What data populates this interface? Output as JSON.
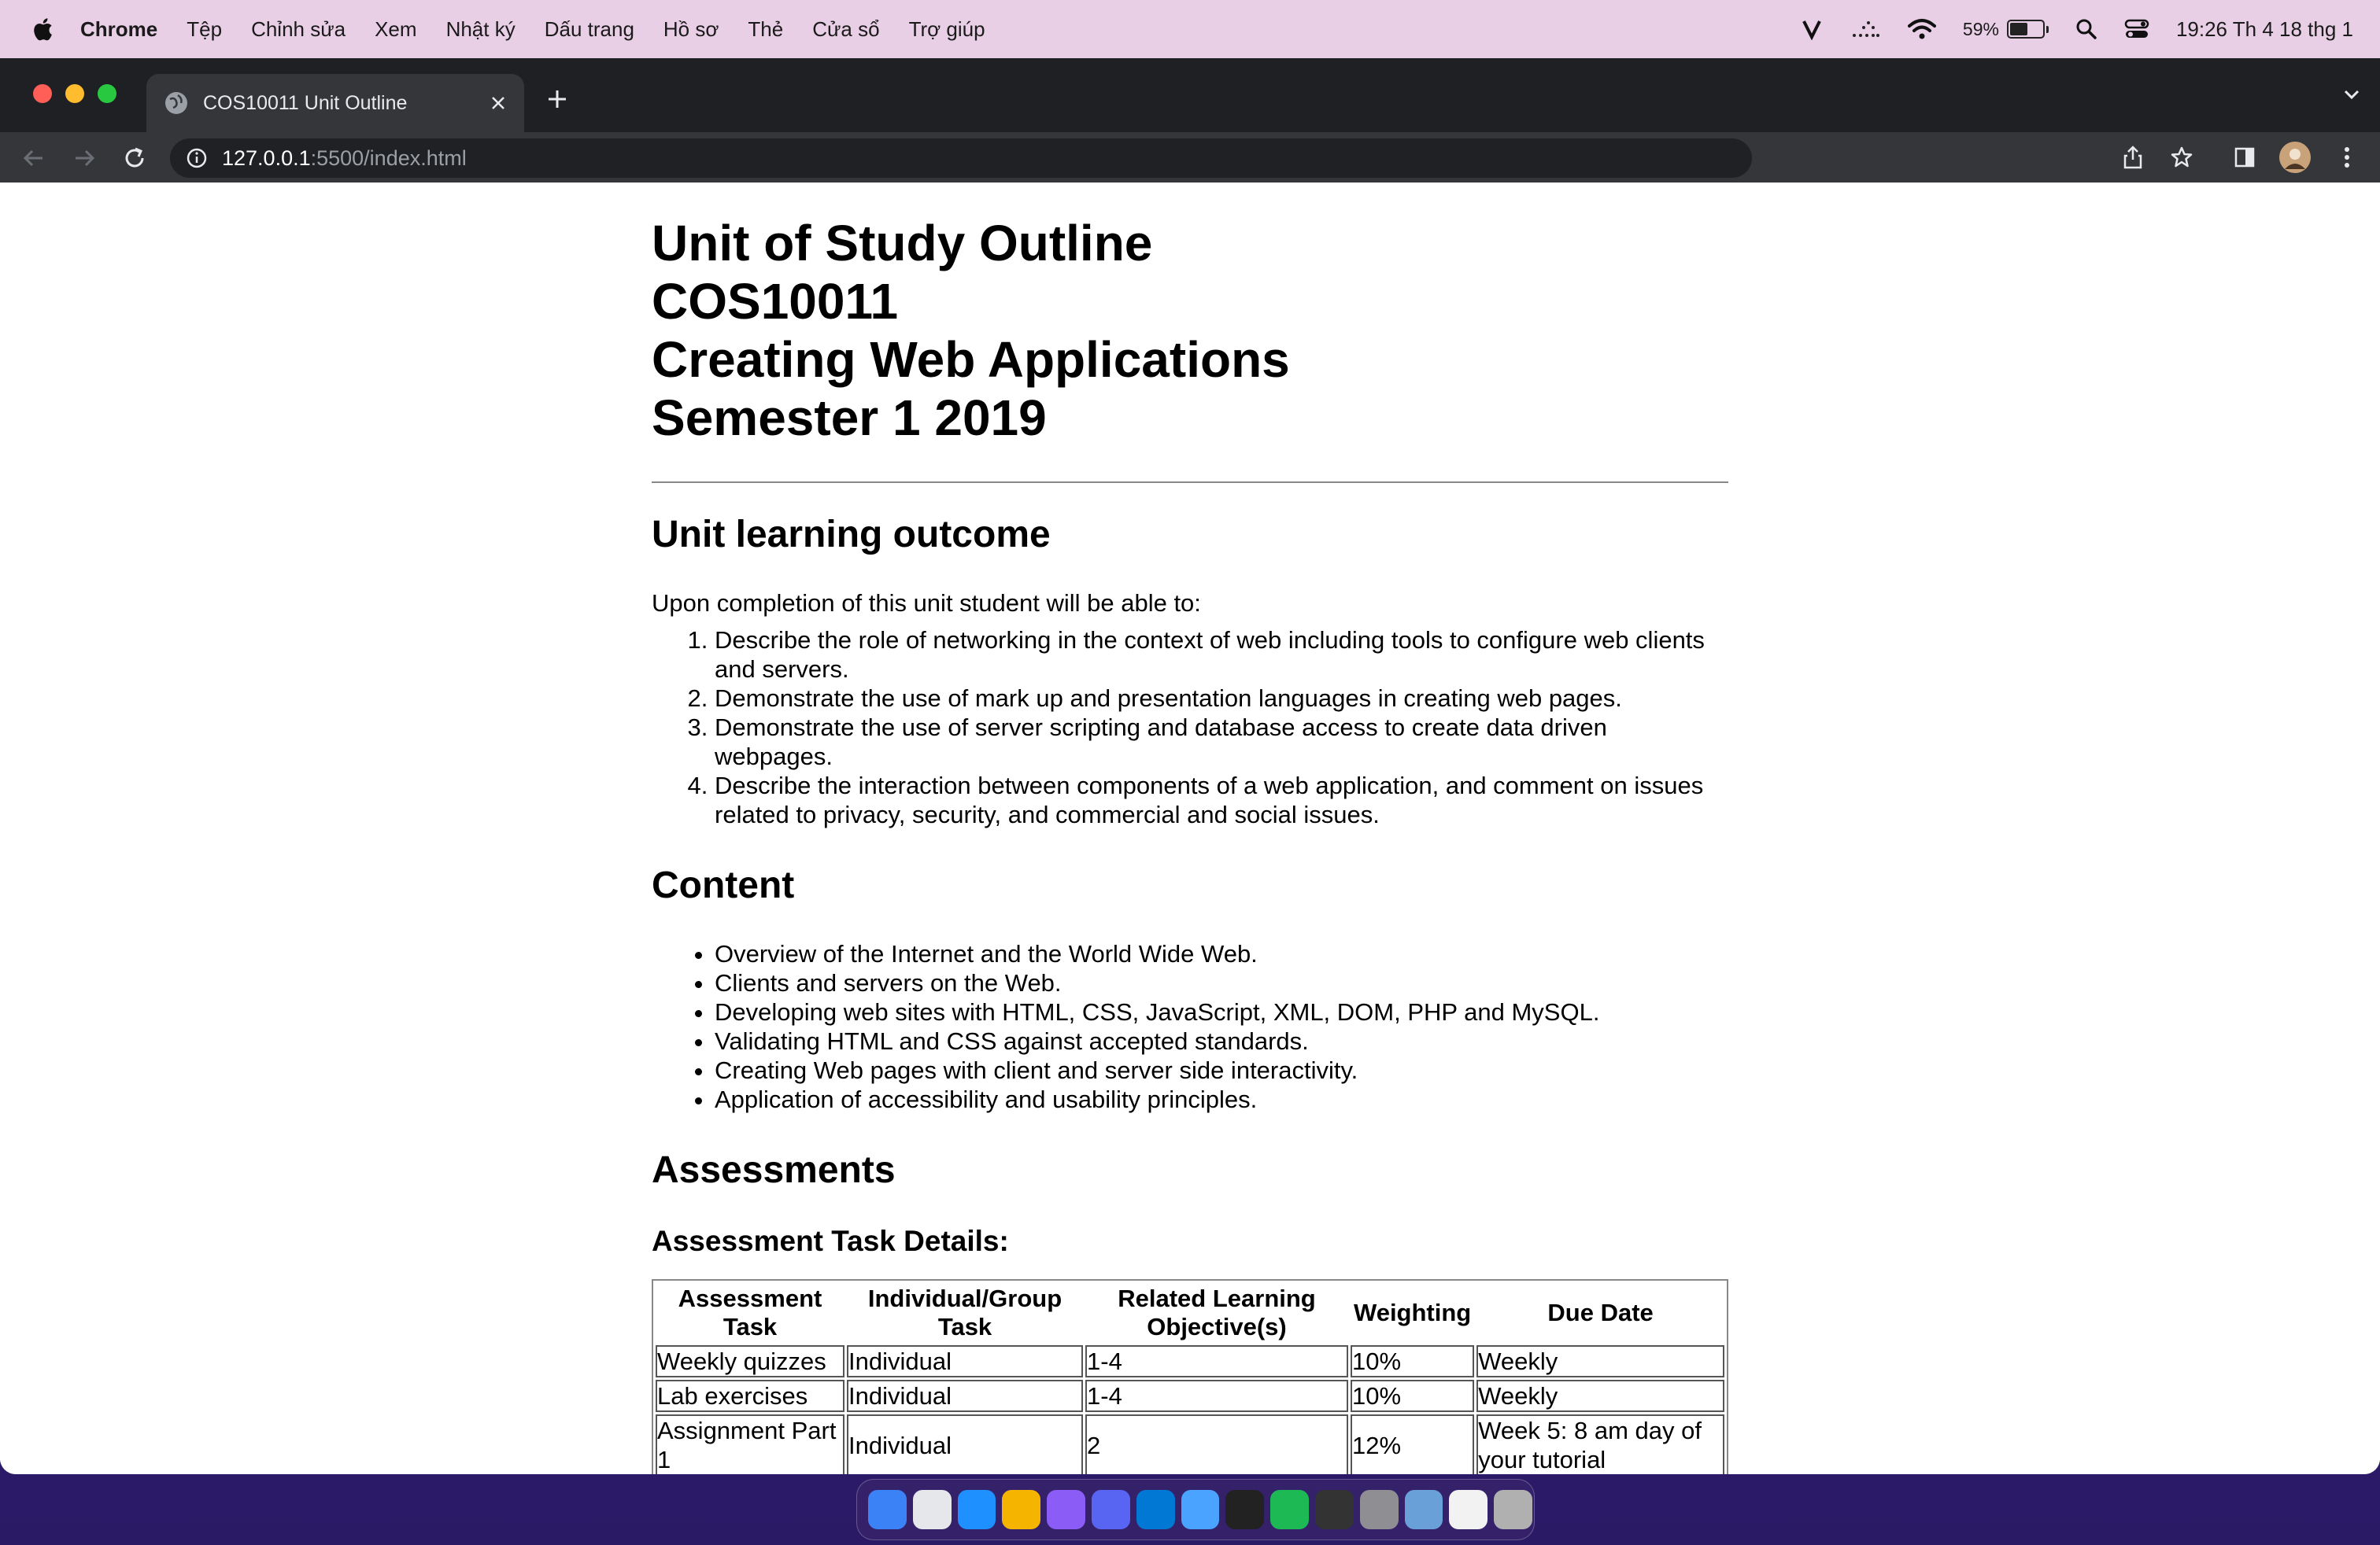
{
  "menubar": {
    "app_name": "Chrome",
    "items": [
      "Tệp",
      "Chỉnh sửa",
      "Xem",
      "Nhật ký",
      "Dấu trang",
      "Hồ sơ",
      "Thẻ",
      "Cửa sổ",
      "Trợ giúp"
    ],
    "battery_percent": "59%",
    "battery_level": 0.59,
    "clock": "19:26 Th 4 18 thg 1"
  },
  "browser": {
    "tab_title": "COS10011 Unit Outline",
    "url_host": "127.0.0.1",
    "url_path": ":5500/index.html"
  },
  "page": {
    "title_lines": [
      "Unit of Study Outline",
      "COS10011",
      "Creating Web Applications",
      "Semester 1 2019"
    ],
    "outcome_heading": "Unit learning outcome",
    "outcome_intro": "Upon completion of this unit student will be able to:",
    "outcomes": [
      "Describe the role of networking in the context of web including tools to configure web clients and servers.",
      "Demonstrate the use of mark up and presentation languages in creating web pages.",
      "Demonstrate the use of server scripting and database access to create data driven webpages.",
      "Describe the interaction between components of a web application, and comment on issues related to privacy, security, and commercial and social issues."
    ],
    "content_heading": "Content",
    "content_items": [
      "Overview of the Internet and the World Wide Web.",
      "Clients and servers on the Web.",
      "Developing web sites with HTML, CSS, JavaScript, XML, DOM, PHP and MySQL.",
      "Validating HTML and CSS against accepted standards.",
      "Creating Web pages with client and server side interactivity.",
      "Application of accessibility and usability principles."
    ],
    "assessments_heading": "Assessments",
    "task_details_heading": "Assessment Task Details:",
    "table": {
      "headers": [
        "Assessment Task",
        "Individual/Group Task",
        "Related Learning Objective(s)",
        "Weighting",
        "Due Date"
      ],
      "rows": [
        [
          "Weekly quizzes",
          "Individual",
          "1-4",
          "10%",
          "Weekly"
        ],
        [
          "Lab exercises",
          "Individual",
          "1-4",
          "10%",
          "Weekly"
        ],
        [
          "Assignment Part 1",
          "Individual",
          "2",
          "12%",
          "Week 5: 8 am day of your tutorial"
        ]
      ]
    }
  },
  "dock": {
    "apps": [
      "finder-icon",
      "launchpad-icon",
      "safari-icon",
      "chrome-icon",
      "messenger-icon",
      "discord-icon",
      "vscode-icon",
      "xcode-icon",
      "terminal-icon",
      "spotify-icon",
      "activity-monitor-icon",
      "system-settings-icon",
      "preview-icon",
      "document-icon",
      "trash-icon"
    ],
    "colors": [
      "#3b82f6",
      "#e5e7eb",
      "#1e90ff",
      "#f4b400",
      "#8b5cf6",
      "#5865f2",
      "#0078d4",
      "#4aa3ff",
      "#222222",
      "#1db954",
      "#333333",
      "#8e8e93",
      "#6aa0d8",
      "#f2f2f2",
      "#b0b0b0"
    ]
  },
  "colors": {
    "menubar_bg": "#e9cfe6",
    "tabstrip_bg": "#1f2024",
    "toolbar_bg": "#35363a",
    "close_red": "#ff5f57",
    "minimize_yellow": "#febc2e",
    "zoom_green": "#28c840"
  }
}
